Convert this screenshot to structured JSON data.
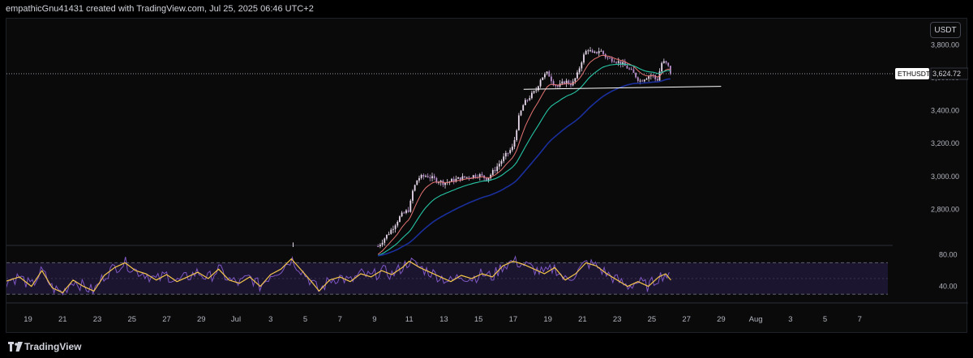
{
  "header": {
    "attribution": "empathicGnu41431 created with TradingView.com, Jul 25, 2025 06:46 UTC+2"
  },
  "toolbar": {
    "currency": "USDT"
  },
  "footer": {
    "brand": "TradingView"
  },
  "colors": {
    "background": "#0a0a0a",
    "candle": "#e8d9ec",
    "candle_down": "#b98fce",
    "ema_fast": "#e57373",
    "ema_mid": "#26c6a6",
    "ema_slow": "#1a2f9c",
    "support_line": "#ffffff",
    "rsi": "#7e57c2",
    "rsi_ma": "#f5c74a",
    "rsi_band": "#1c1530"
  },
  "chart_data": [
    {
      "type": "candlestick",
      "symbol": "ETHUSDT",
      "last_price_label": "3,624.72",
      "last_price": 3624.72,
      "y_ticks": [
        "3,800.00",
        "3,600.00",
        "3,400.00",
        "3,200.00",
        "3,000.00",
        "2,800.00"
      ],
      "y_tick_values": [
        3800,
        3600,
        3400,
        3200,
        3000,
        2800
      ],
      "ylim": [
        2580,
        3960
      ],
      "x_ticks": [
        "19",
        "21",
        "23",
        "25",
        "27",
        "29",
        "Jul",
        "3",
        "5",
        "7",
        "9",
        "11",
        "13",
        "15",
        "17",
        "19",
        "21",
        "23",
        "25",
        "27",
        "29",
        "Aug",
        "3",
        "5",
        "7"
      ],
      "x_tick_days": [
        -12,
        -10,
        -8,
        -6,
        -4,
        -2,
        0,
        2,
        4,
        6,
        8,
        10,
        12,
        14,
        16,
        18,
        20,
        22,
        24,
        26,
        28,
        30,
        32,
        34,
        36
      ],
      "price_path": [
        [
          8.2,
          2575
        ],
        [
          9.0,
          2680
        ],
        [
          9.5,
          2760
        ],
        [
          10.0,
          2800
        ],
        [
          10.2,
          2910
        ],
        [
          10.5,
          2990
        ],
        [
          11.0,
          3005
        ],
        [
          11.5,
          2980
        ],
        [
          12.0,
          2960
        ],
        [
          12.5,
          2975
        ],
        [
          13.0,
          2990
        ],
        [
          13.5,
          3000
        ],
        [
          14.0,
          3010
        ],
        [
          14.5,
          2985
        ],
        [
          15.0,
          3050
        ],
        [
          15.5,
          3120
        ],
        [
          16.0,
          3180
        ],
        [
          16.3,
          3350
        ],
        [
          16.6,
          3440
        ],
        [
          17.0,
          3490
        ],
        [
          17.3,
          3520
        ],
        [
          17.6,
          3600
        ],
        [
          18.0,
          3630
        ],
        [
          18.3,
          3570
        ],
        [
          18.6,
          3545
        ],
        [
          19.0,
          3580
        ],
        [
          19.4,
          3560
        ],
        [
          19.7,
          3620
        ],
        [
          20.0,
          3720
        ],
        [
          20.3,
          3780
        ],
        [
          20.6,
          3740
        ],
        [
          21.0,
          3770
        ],
        [
          21.4,
          3720
        ],
        [
          21.8,
          3710
        ],
        [
          22.2,
          3690
        ],
        [
          22.6,
          3660
        ],
        [
          23.0,
          3620
        ],
        [
          23.3,
          3580
        ],
        [
          23.6,
          3600
        ],
        [
          24.0,
          3620
        ],
        [
          24.3,
          3580
        ],
        [
          24.6,
          3700
        ],
        [
          24.9,
          3680
        ],
        [
          25.1,
          3624.72
        ]
      ],
      "support_level": 3530,
      "support_range_days": [
        16.6,
        28.0
      ],
      "early_spikes": [
        [
          3.3,
          2580
        ],
        [
          -15.4,
          2575
        ]
      ]
    },
    {
      "type": "line",
      "indicator": "RSI",
      "y_ticks": [
        "80.00",
        "40.00"
      ],
      "y_tick_values": [
        80,
        40
      ],
      "ylim": [
        20,
        90
      ],
      "band": [
        30,
        70
      ],
      "series": [
        {
          "values": [
            [
              -13.5,
              45
            ],
            [
              -12.5,
              52
            ],
            [
              -11.8,
              40
            ],
            [
              -11.2,
              60
            ],
            [
              -10.6,
              38
            ],
            [
              -10.0,
              32
            ],
            [
              -9.4,
              48
            ],
            [
              -8.8,
              40
            ],
            [
              -8.2,
              34
            ],
            [
              -7.6,
              54
            ],
            [
              -7.0,
              64
            ],
            [
              -6.4,
              70
            ],
            [
              -5.8,
              60
            ],
            [
              -5.2,
              56
            ],
            [
              -4.6,
              48
            ],
            [
              -4.0,
              55
            ],
            [
              -3.4,
              46
            ],
            [
              -2.8,
              52
            ],
            [
              -2.2,
              58
            ],
            [
              -1.6,
              50
            ],
            [
              -1.0,
              62
            ],
            [
              -0.4,
              48
            ],
            [
              0.2,
              44
            ],
            [
              0.8,
              52
            ],
            [
              1.4,
              40
            ],
            [
              2.0,
              55
            ],
            [
              2.6,
              62
            ],
            [
              3.2,
              75
            ],
            [
              3.8,
              60
            ],
            [
              4.4,
              45
            ],
            [
              4.8,
              34
            ],
            [
              5.4,
              48
            ],
            [
              6.0,
              52
            ],
            [
              6.6,
              46
            ],
            [
              7.2,
              56
            ],
            [
              7.8,
              52
            ],
            [
              8.4,
              60
            ],
            [
              9.0,
              55
            ],
            [
              9.6,
              64
            ],
            [
              10.0,
              72
            ],
            [
              10.6,
              64
            ],
            [
              11.2,
              58
            ],
            [
              11.8,
              52
            ],
            [
              12.4,
              46
            ],
            [
              13.0,
              54
            ],
            [
              13.6,
              50
            ],
            [
              14.2,
              56
            ],
            [
              14.8,
              52
            ],
            [
              15.4,
              66
            ],
            [
              16.0,
              72
            ],
            [
              16.6,
              68
            ],
            [
              17.2,
              62
            ],
            [
              17.8,
              56
            ],
            [
              18.4,
              64
            ],
            [
              19.0,
              48
            ],
            [
              19.6,
              56
            ],
            [
              20.2,
              70
            ],
            [
              20.8,
              66
            ],
            [
              21.4,
              56
            ],
            [
              22.0,
              48
            ],
            [
              22.6,
              40
            ],
            [
              23.2,
              46
            ],
            [
              23.8,
              40
            ],
            [
              24.4,
              52
            ],
            [
              24.8,
              56
            ],
            [
              25.1,
              48
            ]
          ]
        }
      ]
    }
  ]
}
